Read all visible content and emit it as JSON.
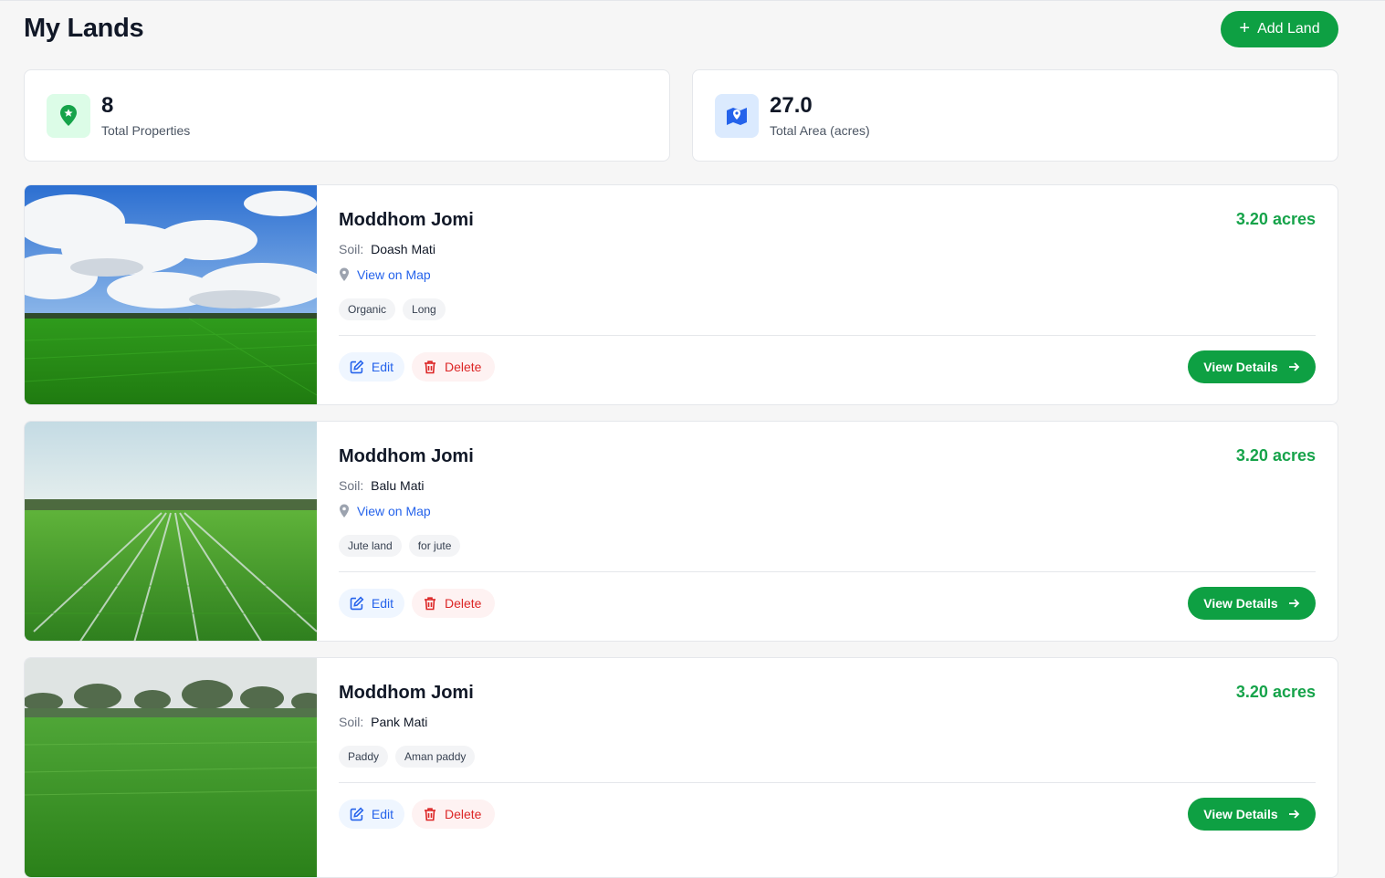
{
  "header": {
    "title": "My Lands",
    "add_label": "Add Land"
  },
  "stats": [
    {
      "value": "8",
      "label": "Total Properties",
      "icon": "map-pin-icon",
      "color": "#16a34a"
    },
    {
      "value": "27.0",
      "label": "Total Area (acres)",
      "icon": "map-icon",
      "color": "#2563eb"
    }
  ],
  "lands": [
    {
      "name": "Moddhom Jomi",
      "area": "3.20 acres",
      "soil_label": "Soil:",
      "soil": "Doash Mati",
      "map_link": "View on Map",
      "tags": [
        "Organic",
        "Long"
      ],
      "edit": "Edit",
      "delete": "Delete",
      "details": "View Details"
    },
    {
      "name": "Moddhom Jomi",
      "area": "3.20 acres",
      "soil_label": "Soil:",
      "soil": "Balu Mati",
      "map_link": "View on Map",
      "tags": [
        "Jute land",
        "for jute"
      ],
      "edit": "Edit",
      "delete": "Delete",
      "details": "View Details"
    },
    {
      "name": "Moddhom Jomi",
      "area": "3.20 acres",
      "soil_label": "Soil:",
      "soil": "Pank Mati",
      "tags": [
        "Paddy",
        "Aman paddy"
      ],
      "edit": "Edit",
      "delete": "Delete",
      "details": "View Details"
    }
  ],
  "colors": {
    "primary": "#0ea043",
    "area_text": "#16a34a",
    "link": "#2563eb",
    "danger": "#dc2626"
  }
}
